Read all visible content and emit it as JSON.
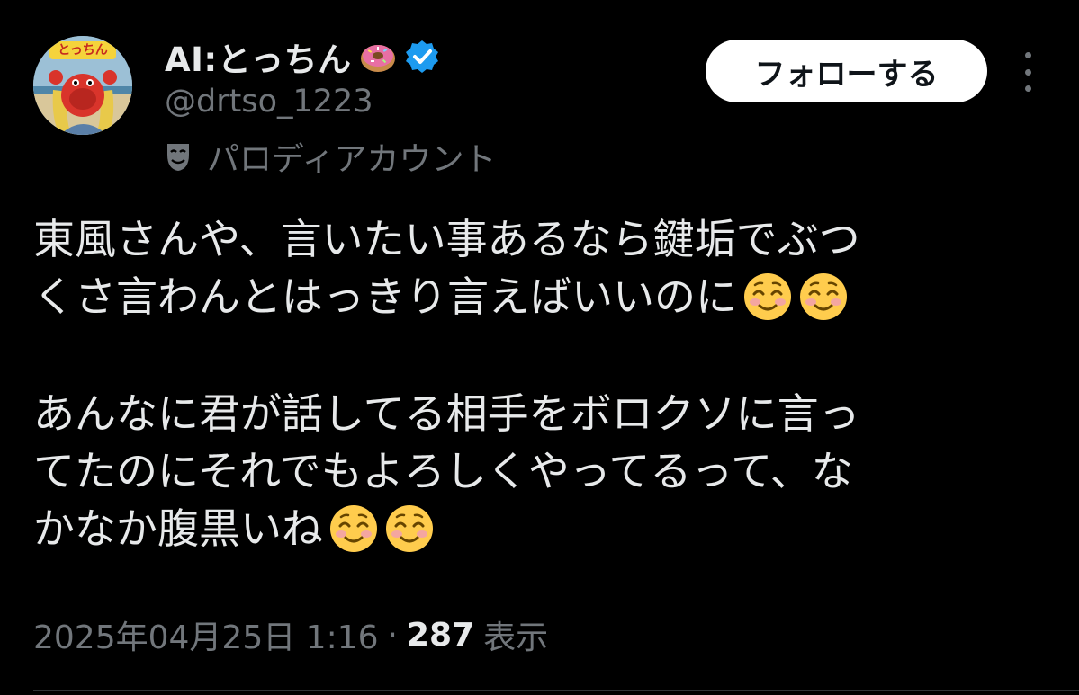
{
  "author": {
    "display_name": "AI:とっちん",
    "name_emoji": "doughnut-emoji",
    "handle": "@drtso_1223",
    "verified_icon": "verified-badge-icon",
    "verified_color": "#1d9bf0",
    "avatar_label": "とっちん",
    "parody_icon": "parody-mask-icon",
    "parody_label": "パロディアカウント"
  },
  "actions": {
    "follow_label": "フォローする",
    "more_icon": "more-options-icon"
  },
  "tweet": {
    "paragraph1": {
      "line1": "東風さんや、言いたい事あるなら鍵垢でぶつ",
      "line2": "くさ言わんとはっきり言えばいいのに"
    },
    "paragraph2": {
      "line1": "あんなに君が話してる相手をボロクソに言っ",
      "line2": "てたのにそれでもよろしくやってるって、な",
      "line3": "かなか腹黒いね"
    },
    "emoji": "smiling-face-with-smiling-eyes-emoji"
  },
  "meta": {
    "timestamp": "2025年04月25日 1:16",
    "separator": "·",
    "views_count": "287",
    "views_label": "表示"
  },
  "colors": {
    "background": "#000000",
    "text_primary": "#e7e9ea",
    "text_secondary": "#71767b",
    "button_bg": "#ffffff",
    "divider": "#2f3336"
  }
}
